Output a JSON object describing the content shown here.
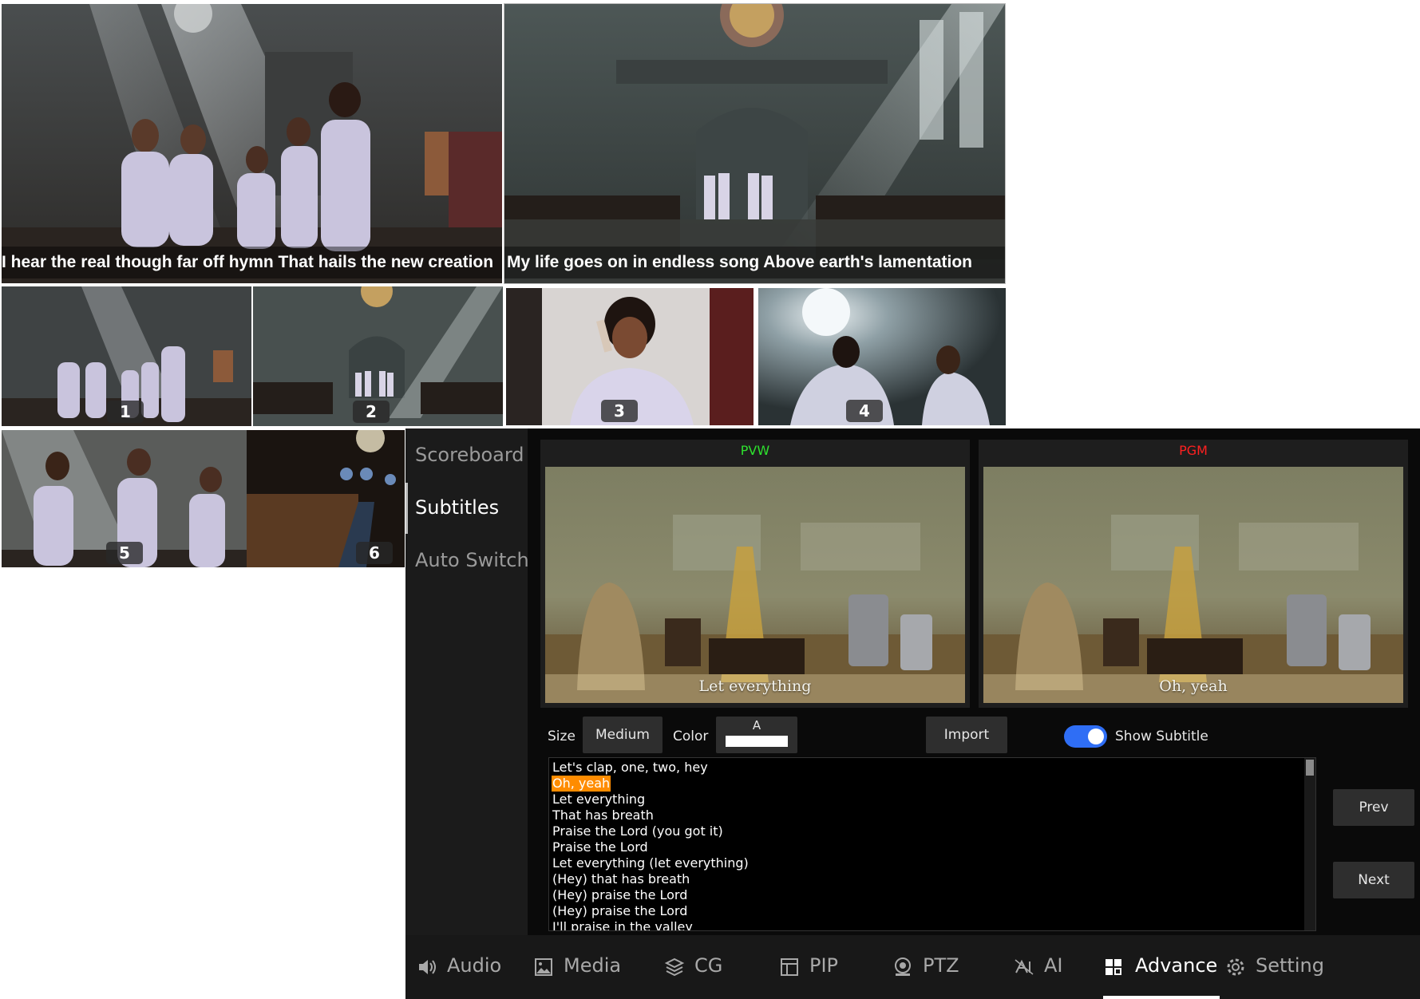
{
  "captions": {
    "main_left": "I hear the real though far off hymn That hails the new creation",
    "main_right": "My life goes on in endless song Above earth's lamentation"
  },
  "sources": [
    "1",
    "2",
    "3",
    "4",
    "5",
    "6"
  ],
  "sidebar": {
    "items": [
      {
        "label": "Scoreboard",
        "active": false
      },
      {
        "label": "Subtitles",
        "active": true
      },
      {
        "label": "Auto Switch",
        "active": false
      }
    ]
  },
  "monitors": {
    "pvw": {
      "label": "PVW",
      "color": "#2ee22e",
      "subtitle": "Let everything"
    },
    "pgm": {
      "label": "PGM",
      "color": "#ff2020",
      "subtitle": "Oh, yeah"
    }
  },
  "controls": {
    "size_label": "Size",
    "size_value": "Medium",
    "color_label": "Color",
    "color_glyph": "A",
    "color_value": "#ffffff",
    "import_label": "Import",
    "show_subtitle_label": "Show Subtitle",
    "show_subtitle": true,
    "prev_label": "Prev",
    "next_label": "Next"
  },
  "lyrics": {
    "lines": [
      "Let's clap, one, two, hey",
      "Oh, yeah",
      "Let everything",
      "That has breath",
      "Praise the Lord (you got it)",
      "Praise the Lord",
      "Let everything (let everything)",
      "(Hey) that has breath",
      "(Hey) praise the Lord",
      "(Hey) praise the Lord",
      "I'll praise in the valley"
    ],
    "current_index": 1
  },
  "nav": {
    "items": [
      {
        "label": "Audio",
        "icon": "speaker-icon"
      },
      {
        "label": "Media",
        "icon": "image-icon"
      },
      {
        "label": "CG",
        "icon": "layers-icon"
      },
      {
        "label": "PIP",
        "icon": "layout-icon"
      },
      {
        "label": "PTZ",
        "icon": "camera-icon"
      },
      {
        "label": "AI",
        "icon": "ai-icon"
      },
      {
        "label": "Advance",
        "icon": "grid-icon"
      },
      {
        "label": "Setting",
        "icon": "gear-icon"
      }
    ],
    "active": "Advance"
  },
  "colors": {
    "accent_blue": "#2f6ef5",
    "highlight_orange": "#ff8c00",
    "preview_green": "#1fc21f",
    "program_red": "#e0262b"
  }
}
